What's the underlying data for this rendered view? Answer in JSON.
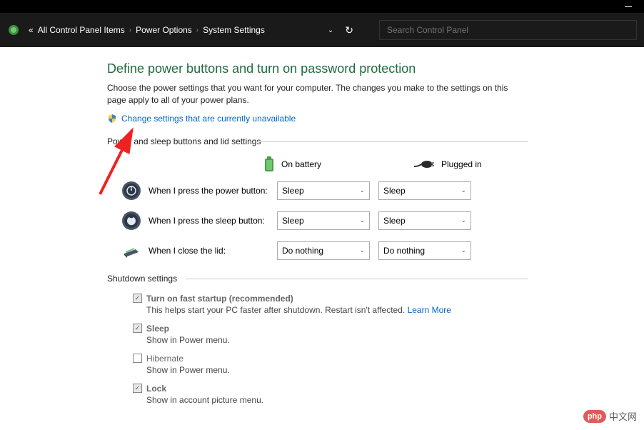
{
  "breadcrumb": {
    "prefix": "«",
    "items": [
      "All Control Panel Items",
      "Power Options",
      "System Settings"
    ]
  },
  "search": {
    "placeholder": "Search Control Panel"
  },
  "page": {
    "title": "Define power buttons and turn on password protection",
    "description": "Choose the power settings that you want for your computer. The changes you make to the settings on this page apply to all of your power plans.",
    "change_link": "Change settings that are currently unavailable"
  },
  "section1": {
    "header": "Power and sleep buttons and lid settings",
    "col_battery": "On battery",
    "col_plugged": "Plugged in",
    "rows": [
      {
        "label": "When I press the power button:",
        "battery": "Sleep",
        "plugged": "Sleep"
      },
      {
        "label": "When I press the sleep button:",
        "battery": "Sleep",
        "plugged": "Sleep"
      },
      {
        "label": "When I close the lid:",
        "battery": "Do nothing",
        "plugged": "Do nothing"
      }
    ]
  },
  "section2": {
    "header": "Shutdown settings",
    "items": [
      {
        "label": "Turn on fast startup (recommended)",
        "bold": true,
        "checked": true,
        "desc": "This helps start your PC faster after shutdown. Restart isn't affected.",
        "learn": "Learn More"
      },
      {
        "label": "Sleep",
        "bold": true,
        "checked": true,
        "desc": "Show in Power menu."
      },
      {
        "label": "Hibernate",
        "bold": false,
        "checked": false,
        "desc": "Show in Power menu."
      },
      {
        "label": "Lock",
        "bold": true,
        "checked": true,
        "desc": "Show in account picture menu."
      }
    ]
  },
  "watermark": {
    "badge": "php",
    "text": "中文网"
  }
}
